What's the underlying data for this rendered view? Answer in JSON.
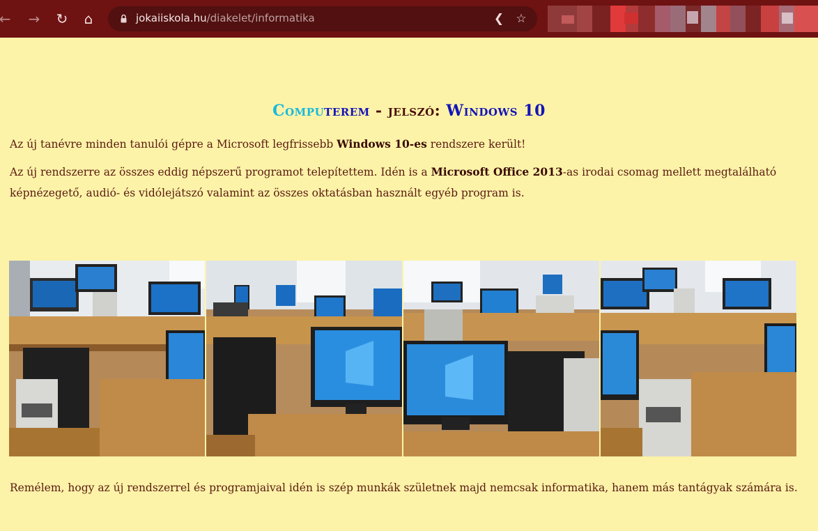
{
  "browser": {
    "url_host": "jokaiiskola.hu",
    "url_path": "/diakelet/informatika",
    "icons": [
      "back-arrow-icon",
      "forward-arrow-icon",
      "reload-icon",
      "home-icon",
      "lock-icon",
      "share-icon",
      "bookmark-star-icon"
    ]
  },
  "page": {
    "title_part1_highlight": "Compu",
    "title_part1_rest": "terem",
    "title_sep": " - jelszó: ",
    "title_part2": "Windows 10",
    "p1_before": "Az új tanévre minden tanulói gépre a Microsoft legfrissebb ",
    "p1_bold": "Windows 10-es",
    "p1_after": " rendszere került!",
    "p2_before": "Az új rendszerre az összes eddig népszerű programot telepítettem. Idén is a ",
    "p2_bold": "Microsoft Office 2013",
    "p2_after": "-as irodai csomag mellett megtalálható képnézegető, audió- és vidólejátszó valamint az összes oktatásban használt egyéb program is.",
    "p3": "Remélem, hogy az új rendszerrel és programjaival idén is szép munkák születnek majd nemcsak informatika, hanem más tantágyak számára is."
  },
  "gallery": {
    "photos": [
      {
        "name": "computer-lab-photo-1"
      },
      {
        "name": "computer-lab-photo-2"
      },
      {
        "name": "computer-lab-photo-3"
      },
      {
        "name": "computer-lab-photo-4"
      }
    ]
  },
  "colors": {
    "page_background": "#fcf3a8",
    "chrome_background": "#6e1212",
    "title_cyan": "#18b9dc",
    "title_blue": "#1414b9",
    "text_brown": "#5a1a10"
  }
}
